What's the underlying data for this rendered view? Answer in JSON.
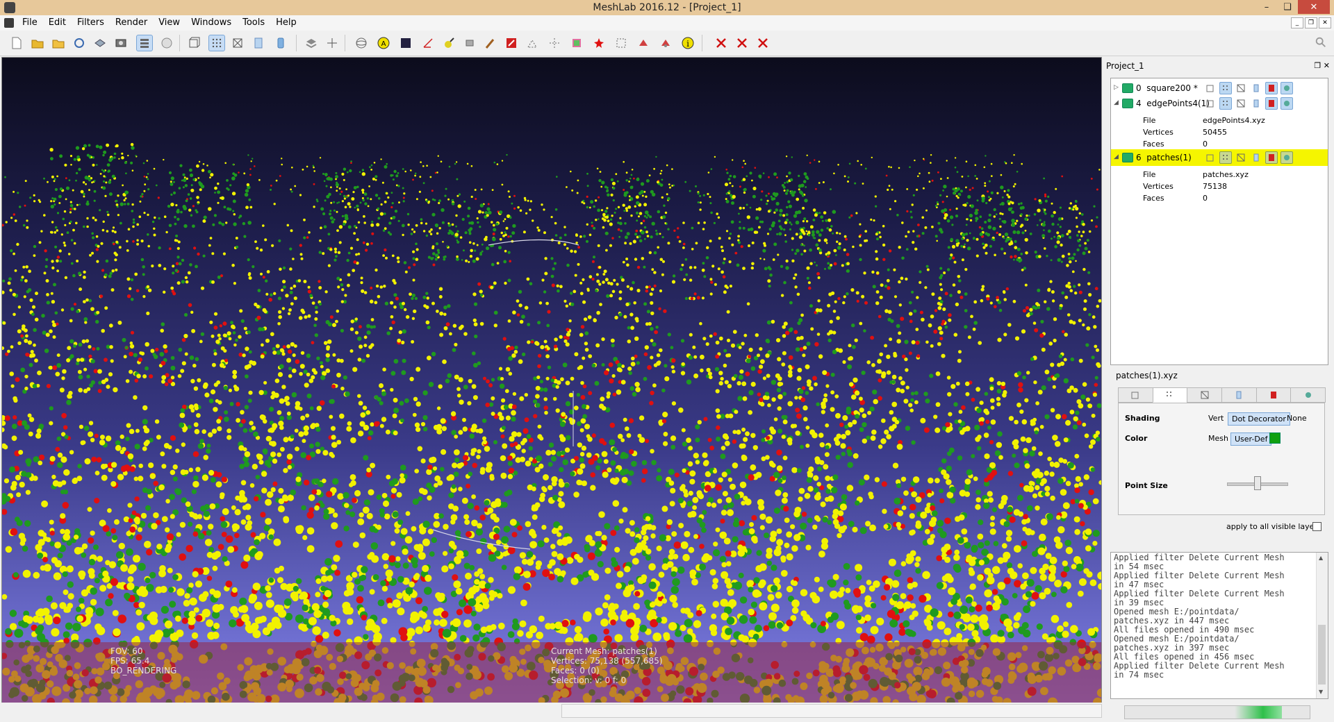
{
  "window": {
    "title": "MeshLab 2016.12 - [Project_1]"
  },
  "menu": [
    "File",
    "Edit",
    "Filters",
    "Render",
    "View",
    "Windows",
    "Tools",
    "Help"
  ],
  "toolbar": {
    "icons": [
      "new-project-icon",
      "open-project-icon",
      "open-mesh-icon",
      "reload-icon",
      "save-icon",
      "snapshot-icon",
      "layer-dialog-icon",
      "bbox-icon",
      "points-render-icon",
      "wireframe-icon",
      "flat-icon",
      "smooth-icon",
      "texture-icon",
      "light-icon",
      "edit-annotation-icon",
      "color-picker-icon",
      "align-icon",
      "paint-icon",
      "select-faces-icon",
      "select-vertex-icon",
      "measure-icon",
      "georef-icon",
      "pick-points-icon",
      "rotate-icon",
      "info-icon",
      "delete-face-icon",
      "delete-vertex-icon",
      "delete-all-icon"
    ]
  },
  "layers": {
    "panel_title": "Project_1",
    "items": [
      {
        "index": "0",
        "name": "square200 *",
        "selected": false,
        "expanded": false
      },
      {
        "index": "4",
        "name": "edgePoints4(1)",
        "selected": false,
        "expanded": true,
        "props": [
          {
            "k": "File",
            "v": "edgePoints4.xyz"
          },
          {
            "k": "Vertices",
            "v": "50455"
          },
          {
            "k": "Faces",
            "v": "0"
          }
        ]
      },
      {
        "index": "6",
        "name": "patches(1)",
        "selected": true,
        "expanded": true,
        "props": [
          {
            "k": "File",
            "v": "patches.xyz"
          },
          {
            "k": "Vertices",
            "v": "75138"
          },
          {
            "k": "Faces",
            "v": "0"
          }
        ]
      }
    ]
  },
  "props_panel": {
    "filename": "patches(1).xyz",
    "shading_label": "Shading",
    "shading_vert": "Vert",
    "shading_value": "Dot Decorator",
    "shading_none": "None",
    "color_label": "Color",
    "color_mesh": "Mesh",
    "color_value": "User-Def",
    "color_swatch": "#10a010",
    "pointsize_label": "Point Size",
    "pointsize_level": 0.45,
    "apply_label": "apply to all visible layers",
    "apply_checked": false
  },
  "log": [
    "Applied filter Delete Current Mesh",
    "in 54 msec",
    "Applied filter Delete Current Mesh",
    "in 47 msec",
    "Applied filter Delete Current Mesh",
    "in 39 msec",
    "Opened mesh E:/pointdata/",
    "patches.xyz in 447 msec",
    "All files opened in 490 msec",
    "Opened mesh E:/pointdata/",
    "patches.xyz in 397 msec",
    "All files opened in 456 msec",
    "Applied filter Delete Current Mesh",
    "in 74 msec"
  ],
  "hud": {
    "fov": "FOV: 60",
    "fps": "FPS:   65.4",
    "mode": "BO_RENDERING",
    "current_mesh": "Current Mesh: patches(1)",
    "vertices": "Vertices: 75,138    (557,685)",
    "faces": "Faces: 0    (0)",
    "selection": "Selection: v: 0 f: 0"
  },
  "status": {
    "progress": 0.85
  },
  "colors": {
    "point_yellow": "#f2f200",
    "point_green": "#1f9a1f",
    "point_red": "#e01010",
    "sky": "#1a1a40",
    "ground": "#6f6fd6",
    "hud": "#962846",
    "selection": "#f5f500"
  }
}
